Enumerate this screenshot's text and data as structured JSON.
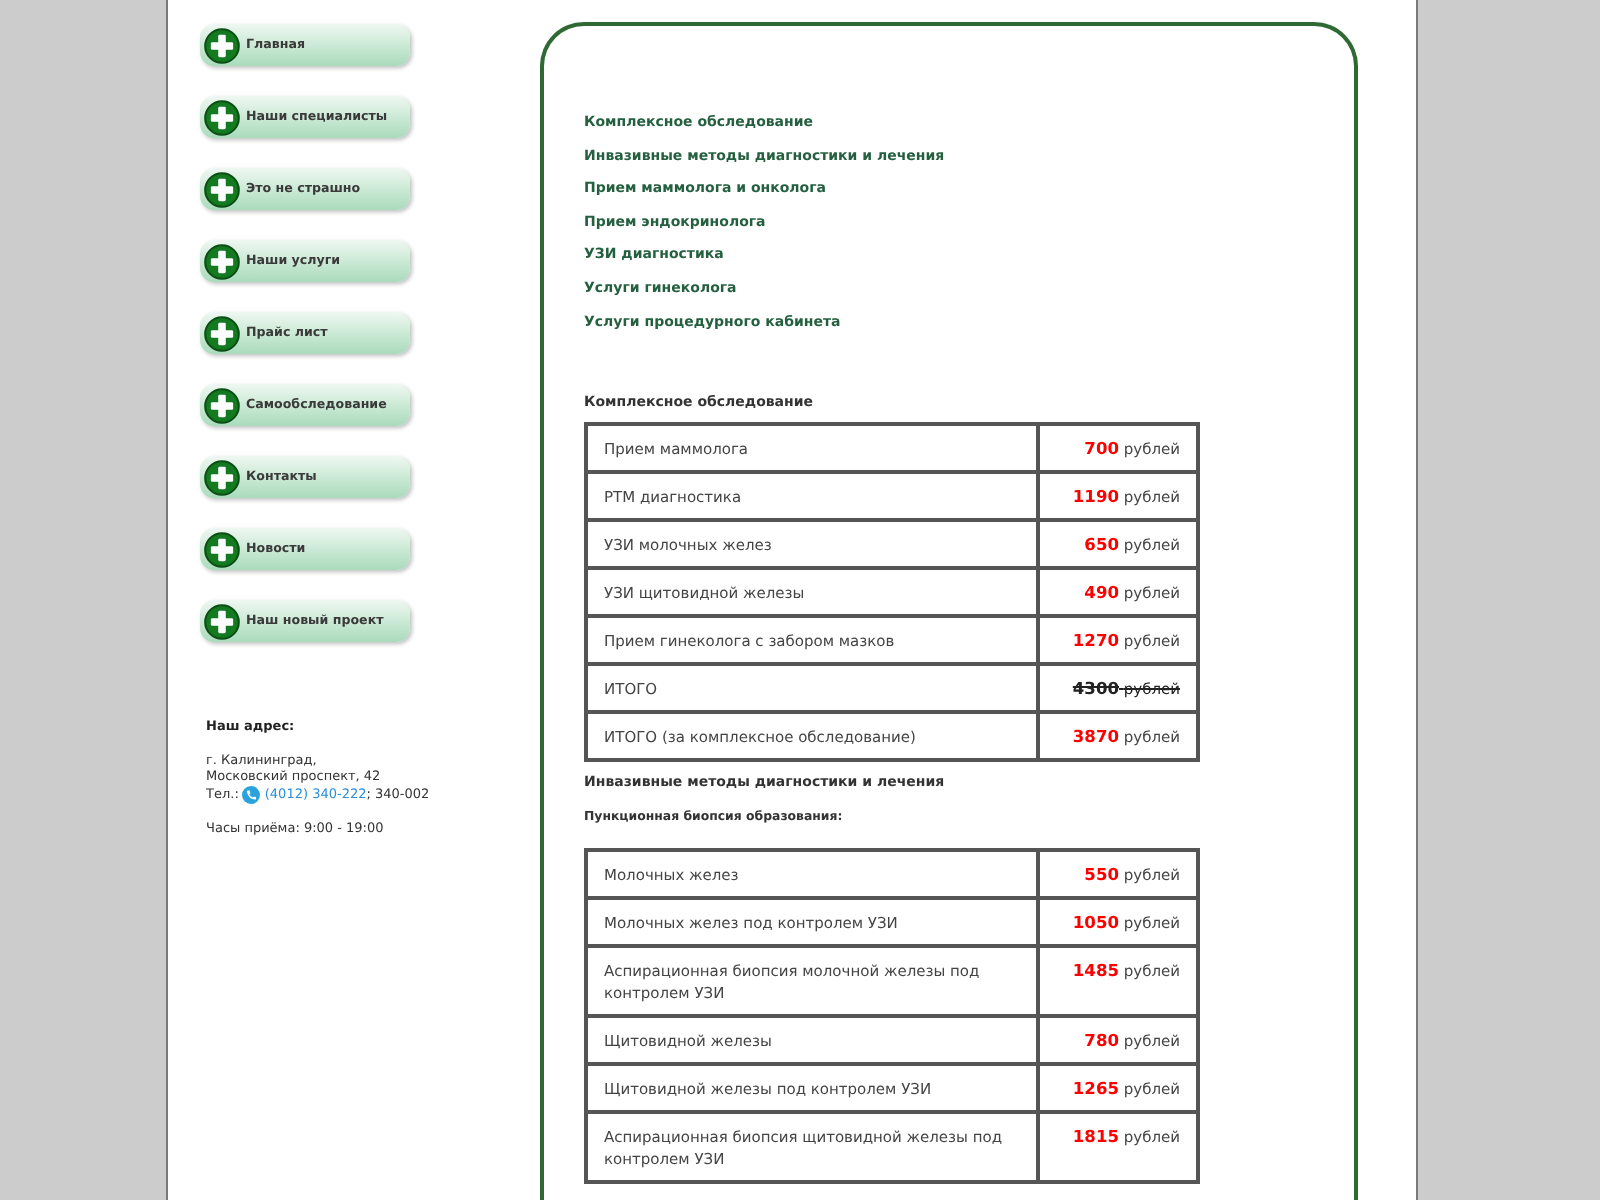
{
  "sidebar": {
    "menu": [
      {
        "label": "Главная"
      },
      {
        "label": "Наши специалисты"
      },
      {
        "label": "Это не страшно"
      },
      {
        "label": "Наши услуги"
      },
      {
        "label": "Прайс лист"
      },
      {
        "label": "Самообследование"
      },
      {
        "label": "Контакты"
      },
      {
        "label": "Новости"
      },
      {
        "label": "Наш новый проект"
      }
    ],
    "address": {
      "heading": "Наш адрес:",
      "lines": [
        "г. Калининград,",
        "Московский проспект, 42"
      ],
      "phone": {
        "label": "Тел.:",
        "link": "(4012) 340-222",
        "rest": "; 340-002"
      },
      "hours": "Часы приёма: 9:00 - 19:00"
    }
  },
  "content": {
    "links": [
      "Комплексное обследование",
      "Инвазивные методы диагностики и лечения",
      "Прием маммолога и онколога",
      "Прием эндокринолога",
      "УЗИ диагностика",
      "Услуги гинеколога",
      "Услуги процедурного кабинета"
    ],
    "sections": [
      {
        "title": "Комплексное обследование",
        "rows": [
          {
            "service": "Прием маммолога",
            "amount": "700",
            "unit": "рублей",
            "struck": false
          },
          {
            "service": "РТМ диагностика",
            "amount": "1190",
            "unit": "рублей",
            "struck": false
          },
          {
            "service": "УЗИ молочных желез",
            "amount": "650",
            "unit": "рублей",
            "struck": false
          },
          {
            "service": "УЗИ щитовидной железы",
            "amount": "490",
            "unit": "рублей",
            "struck": false
          },
          {
            "service": "Прием гинеколога с забором мазков",
            "amount": "1270",
            "unit": "рублей",
            "struck": false
          },
          {
            "service": "ИТОГО",
            "amount": "4300",
            "unit": "рублей",
            "struck": true
          },
          {
            "service": "ИТОГО (за комплексное обследование)",
            "amount": "3870",
            "unit": "рублей",
            "struck": false
          }
        ]
      },
      {
        "title": "Инвазивные методы диагностики и лечения",
        "subtitle": "Пункционная биопсия образования:",
        "rows": [
          {
            "service": "Молочных желез",
            "amount": "550",
            "unit": "рублей",
            "struck": false
          },
          {
            "service": "Молочных желез под контролем УЗИ",
            "amount": "1050",
            "unit": "рублей",
            "struck": false
          },
          {
            "service": "Аспирационная биопсия молочной железы под контролем УЗИ",
            "amount": "1485",
            "unit": "рублей",
            "struck": false
          },
          {
            "service": "Щитовидной железы",
            "amount": "780",
            "unit": "рублей",
            "struck": false
          },
          {
            "service": "Щитовидной железы под контролем УЗИ",
            "amount": "1265",
            "unit": "рублей",
            "struck": false
          },
          {
            "service": "Аспирационная биопсия щитовидной железы под контролем УЗИ",
            "amount": "1815",
            "unit": "рублей",
            "struck": false
          }
        ]
      }
    ]
  }
}
